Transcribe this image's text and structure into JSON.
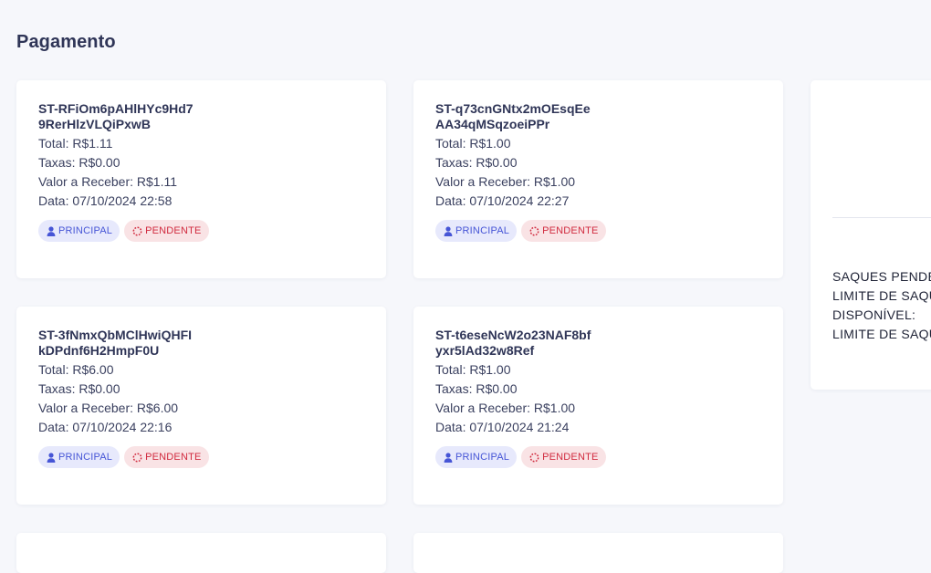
{
  "page": {
    "title": "Pagamento"
  },
  "labels": {
    "total": "Total:",
    "taxas": "Taxas:",
    "valor": "Valor a Receber:",
    "data": "Data:"
  },
  "colors": {
    "principal_bg": "#e7e9fc",
    "principal_fg": "#4655d6",
    "pendente_bg": "#f9e3e5",
    "pendente_fg": "#d12b3f"
  },
  "payments": [
    {
      "id": "ST-RFiOm6pAHlHYc9Hd79RerHlzVLQiPxwB",
      "total": "R$1.11",
      "taxas": "R$0.00",
      "valor": "R$1.11",
      "data": "07/10/2024 22:58",
      "account_badge": "PRINCIPAL",
      "status_badge": "PENDENTE"
    },
    {
      "id": "ST-q73cnGNtx2mOEsqEeAA34qMSqzoeiPPr",
      "total": "R$1.00",
      "taxas": "R$0.00",
      "valor": "R$1.00",
      "data": "07/10/2024 22:27",
      "account_badge": "PRINCIPAL",
      "status_badge": "PENDENTE"
    },
    {
      "id": "ST-3fNmxQbMClHwiQHFIkDPdnf6H2HmpF0U",
      "total": "R$6.00",
      "taxas": "R$0.00",
      "valor": "R$6.00",
      "data": "07/10/2024 22:16",
      "account_badge": "PRINCIPAL",
      "status_badge": "PENDENTE"
    },
    {
      "id": "ST-t6eseNcW2o23NAF8bfyxr5lAd32w8Ref",
      "total": "R$1.00",
      "taxas": "R$0.00",
      "valor": "R$1.00",
      "data": "07/10/2024 21:24",
      "account_badge": "PRINCIPAL",
      "status_badge": "PENDENTE"
    }
  ],
  "side": {
    "items": [
      "SAQUES PENDE",
      "LIMITE DE SAQU",
      "DISPONÍVEL:",
      "LIMITE DE SAQU"
    ]
  },
  "icons": {
    "account": "user-icon",
    "status": "spinner-icon"
  }
}
